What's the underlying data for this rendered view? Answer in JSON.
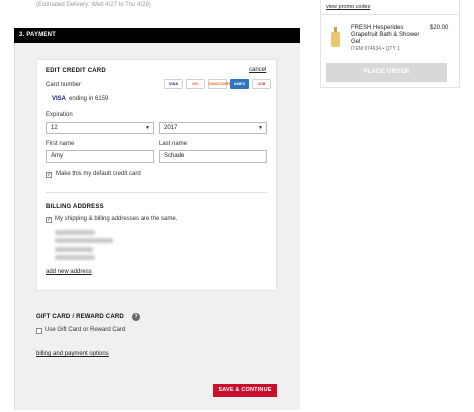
{
  "delivery": {
    "estimate": "(Estimated Delivery: Wed 4/27 to Thu 4/28)"
  },
  "payment": {
    "section_title": "3. PAYMENT",
    "edit_card": {
      "title": "EDIT CREDIT CARD",
      "cancel_label": "cancel",
      "card_number_label": "Card number",
      "card_number_brand": "VISA",
      "card_number_value": "ending in 6159",
      "card_logos": [
        "VISA",
        "MC",
        "DISCOVER",
        "AMEX",
        "JCB"
      ],
      "expiration_label": "Expiration",
      "exp_month": "12",
      "exp_year": "2017",
      "first_name_label": "First name",
      "first_name_value": "Amy",
      "last_name_label": "Last name",
      "last_name_value": "Schade",
      "default_card_label": "Make this my default credit card",
      "default_card_checked": true
    },
    "billing": {
      "title": "BILLING ADDRESS",
      "same_address_label": "My shipping & billing addresses are the same.",
      "same_address_checked": true,
      "add_new_address_label": "add new address"
    },
    "gift": {
      "title": "GIFT CARD / REWARD CARD",
      "help_icon": "?",
      "use_label": "Use Gift Card or Reward Card",
      "use_checked": false
    },
    "billing_options_link": "billing and payment options",
    "save_button": "SAVE & CONTINUE"
  },
  "summary": {
    "promo_link": "view promo codes",
    "item": {
      "name": "FRESH Hesperides Grapefruit Bath & Shower Gel",
      "price": "$20.00",
      "meta": "ITEM 974634 • QTY 1"
    },
    "place_order_button": "PLACE ORDER"
  },
  "colors": {
    "accent": "#c8102e",
    "header": "#000000",
    "disabled": "#d8d8d8"
  }
}
